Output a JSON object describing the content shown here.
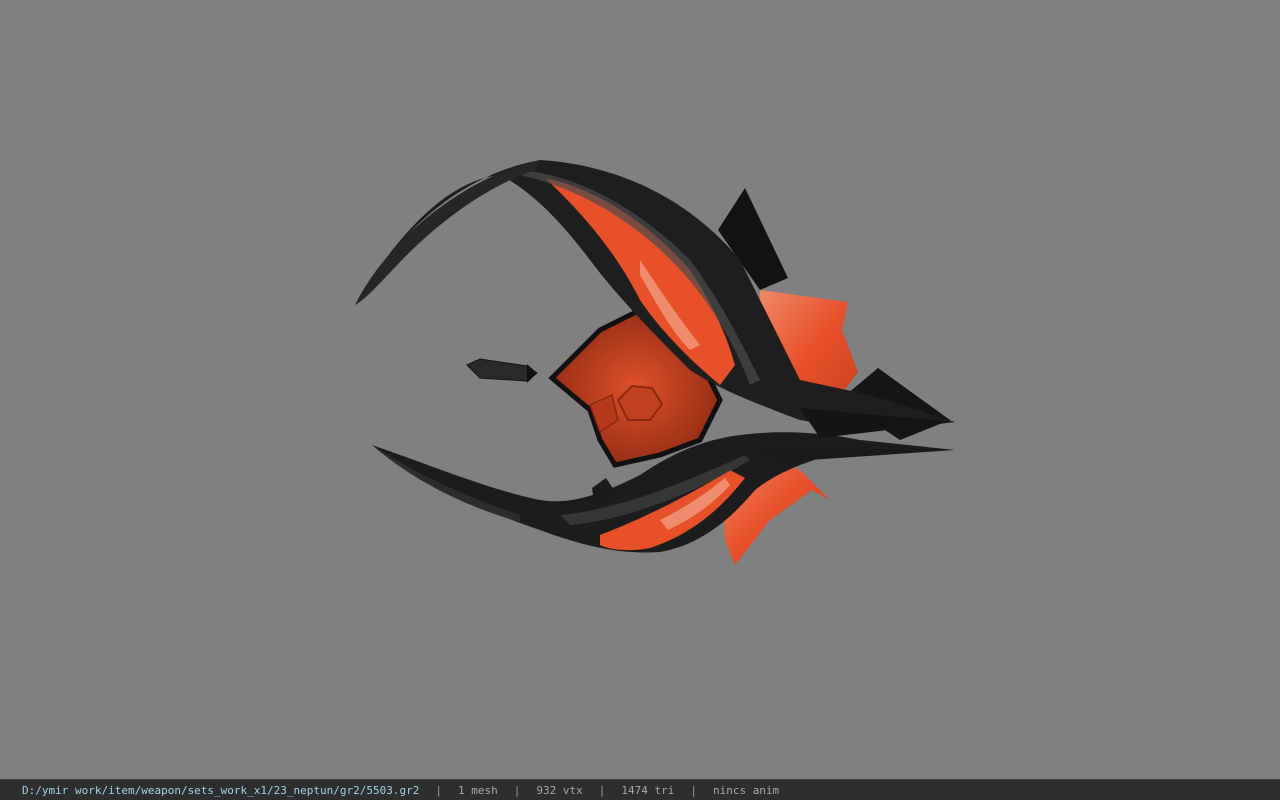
{
  "viewport": {
    "background_color": "#808080",
    "model_colors": {
      "dark": "#1c1c1c",
      "mid_dark": "#2e2e2e",
      "orange": "#e8502a",
      "orange_light": "#f08060",
      "orange_deep": "#b8381c"
    }
  },
  "statusbar": {
    "file_path": "D:/ymir work/item/weapon/sets_work_x1/23_neptun/gr2/5503.gr2",
    "separator": "|",
    "mesh_count": "1 mesh",
    "vertex_count": "932 vtx",
    "triangle_count": "1474 tri",
    "animation_status": "nincs anim"
  }
}
